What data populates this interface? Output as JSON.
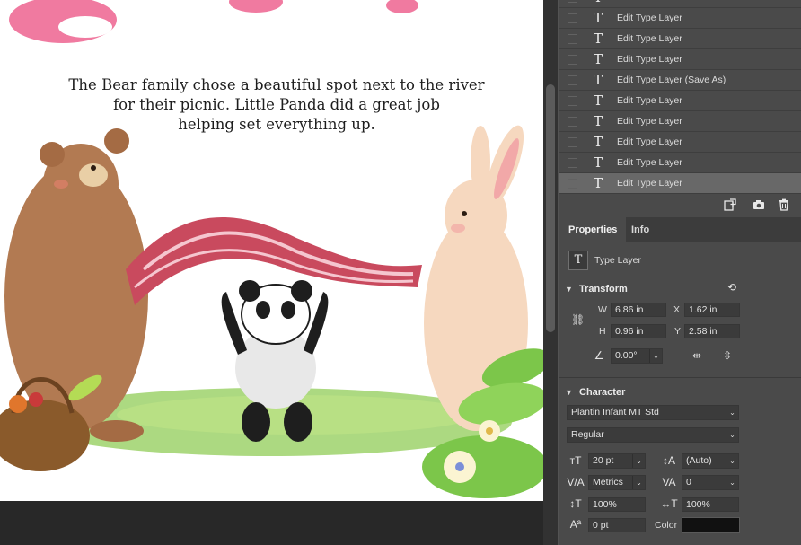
{
  "canvas": {
    "story_text": "The Bear family chose a beautiful spot next to the river\nfor their picnic. Little Panda did a great job\nhelping set everything up."
  },
  "history": {
    "items": [
      {
        "label": "Edit Type Layer",
        "selected": false
      },
      {
        "label": "Edit Type Layer",
        "selected": false
      },
      {
        "label": "Edit Type Layer",
        "selected": false
      },
      {
        "label": "Edit Type Layer (Save As)",
        "selected": false
      },
      {
        "label": "Edit Type Layer",
        "selected": false
      },
      {
        "label": "Edit Type Layer",
        "selected": false
      },
      {
        "label": "Edit Type Layer",
        "selected": false
      },
      {
        "label": "Edit Type Layer",
        "selected": false
      },
      {
        "label": "Edit Type Layer",
        "selected": true
      }
    ],
    "icons": [
      "new-document-from-state-icon",
      "camera-icon",
      "trash-icon"
    ]
  },
  "panel_tabs": {
    "properties": "Properties",
    "info": "Info"
  },
  "properties": {
    "layer_kind": "Type Layer",
    "transform": {
      "title": "Transform",
      "w_label": "W",
      "w": "6.86 in",
      "h_label": "H",
      "h": "0.96 in",
      "x_label": "X",
      "x": "1.62 in",
      "y_label": "Y",
      "y": "2.58 in",
      "angle": "0.00°"
    },
    "character": {
      "title": "Character",
      "font_family": "Plantin Infant MT Std",
      "font_style": "Regular",
      "size": "20 pt",
      "leading": "(Auto)",
      "kerning": "Metrics",
      "tracking": "0",
      "vertical_scale": "100%",
      "horizontal_scale": "100%",
      "baseline_shift": "0 pt",
      "color_label": "Color",
      "color": "#111111"
    }
  }
}
